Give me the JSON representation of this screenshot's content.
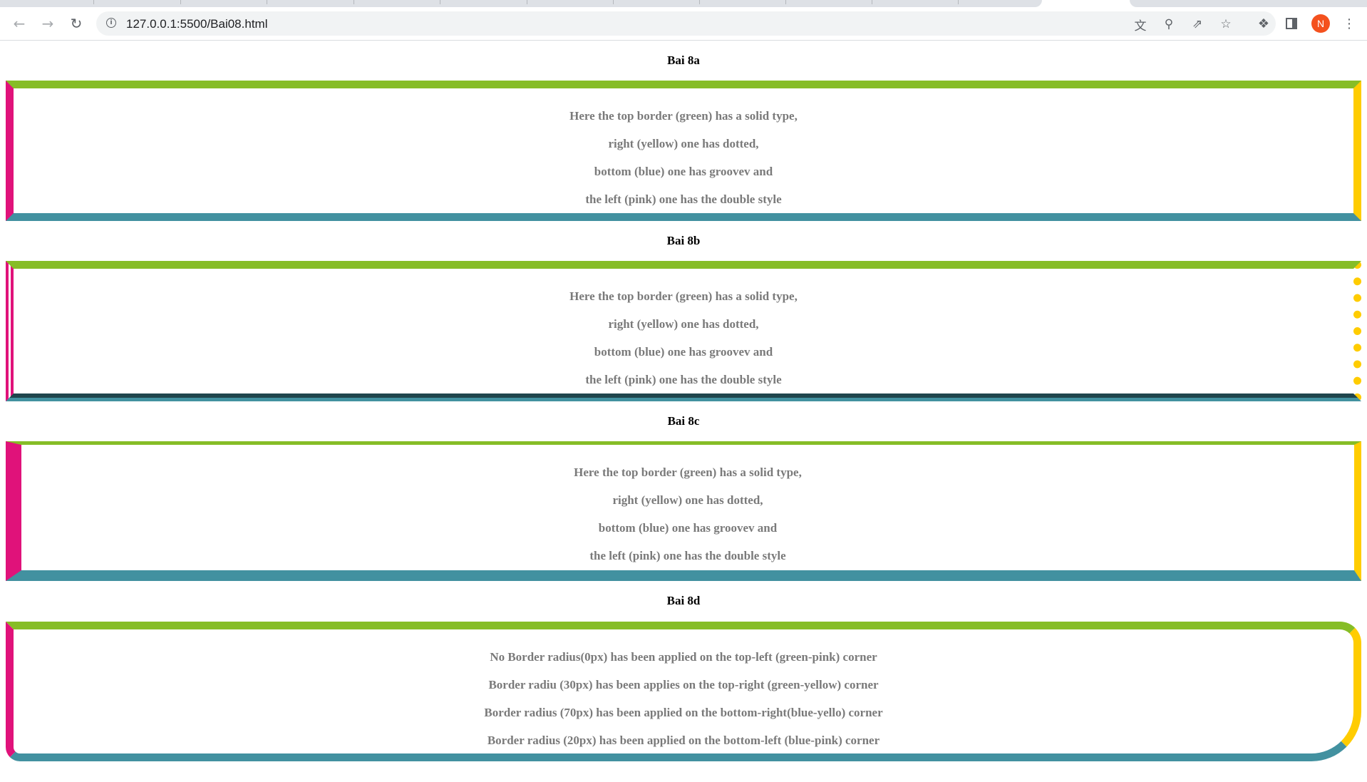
{
  "browser": {
    "url": "127.0.0.1:5500/Bai08.html",
    "profile_initial": "N",
    "profile_color": "#f4511e",
    "icons": {
      "back": "arrow-left-icon",
      "forward": "arrow-right-icon",
      "reload": "reload-icon",
      "site_info": "info-icon",
      "translate": "translate-icon",
      "zoom": "zoom-out-icon",
      "share": "share-icon",
      "bookmark": "star-icon",
      "extensions": "puzzle-icon",
      "side_panel": "side-panel-icon",
      "menu": "kebab-menu-icon"
    }
  },
  "colors": {
    "green": "#86bd26",
    "yellow": "#ffcc00",
    "blue": "#4291a0",
    "pink": "#e0127a",
    "text": "#7a7a7a"
  },
  "sections": [
    {
      "title": "Bai 8a",
      "lines": [
        "Here the top border (green) has a solid type,",
        "right (yellow) one has dotted,",
        "bottom (blue) one has groovev and",
        "the left (pink) one has the double style"
      ]
    },
    {
      "title": "Bai 8b",
      "lines": [
        "Here the top border (green) has a solid type,",
        "right (yellow) one has dotted,",
        "bottom (blue) one has groovev and",
        "the left (pink) one has the double style"
      ]
    },
    {
      "title": "Bai 8c",
      "lines": [
        "Here the top border (green) has a solid type,",
        "right (yellow) one has dotted,",
        "bottom (blue) one has groovev and",
        "the left (pink) one has the double style"
      ]
    },
    {
      "title": "Bai 8d",
      "lines": [
        "No Border radius(0px) has been applied on the top-left (green-pink) corner",
        "Border radiu (30px) has been applies on the top-right (green-yellow) corner",
        "Border radius (70px) has been applied on the bottom-right(blue-yello) corner",
        "Border radius (20px) has been applied on the bottom-left (blue-pink) corner"
      ]
    }
  ]
}
